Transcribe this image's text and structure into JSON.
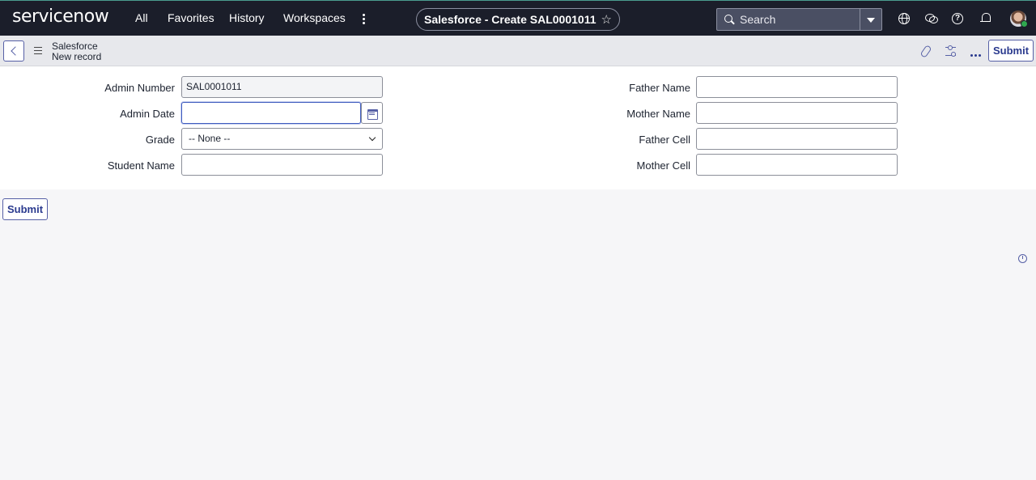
{
  "brand": {
    "logo_text": "servicenow"
  },
  "nav": {
    "all": "All",
    "favorites": "Favorites",
    "history": "History",
    "workspaces": "Workspaces"
  },
  "context_title": "Salesforce - Create SAL0001011",
  "search": {
    "placeholder": "Search"
  },
  "header": {
    "crumb_table": "Salesforce",
    "crumb_record": "New record",
    "submit_label": "Submit"
  },
  "form": {
    "admin_number": {
      "label": "Admin Number",
      "value": "SAL0001011"
    },
    "admin_date": {
      "label": "Admin Date",
      "value": ""
    },
    "grade": {
      "label": "Grade",
      "value": "-- None --"
    },
    "student_name": {
      "label": "Student Name",
      "value": ""
    },
    "father_name": {
      "label": "Father Name",
      "value": ""
    },
    "mother_name": {
      "label": "Mother Name",
      "value": ""
    },
    "father_cell": {
      "label": "Father Cell",
      "value": ""
    },
    "mother_cell": {
      "label": "Mother Cell",
      "value": ""
    }
  },
  "footer": {
    "submit_label": "Submit"
  },
  "colors": {
    "topbar": "#1b1e2a",
    "accent": "#5660a6",
    "focus": "#3f5bbf"
  }
}
